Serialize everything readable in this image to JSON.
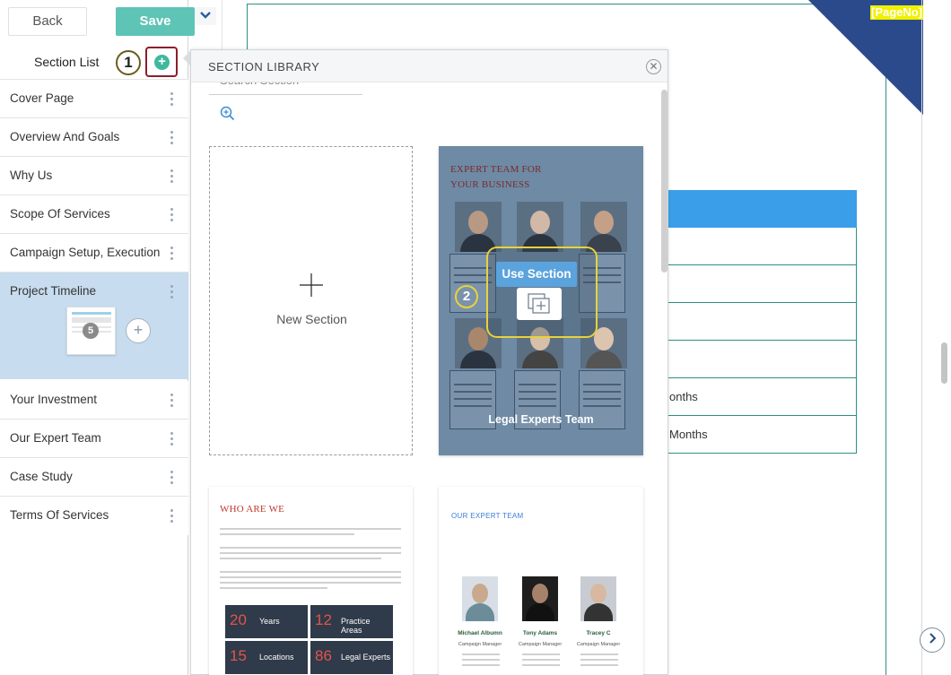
{
  "toolbar": {
    "back_label": "Back",
    "save_label": "Save",
    "dropdown_icon": "chevron-down-icon"
  },
  "section_list": {
    "title": "Section List",
    "step_badge": "1",
    "add_icon": "plus-circle-icon",
    "items": [
      {
        "label": "Cover Page"
      },
      {
        "label": "Overview And Goals"
      },
      {
        "label": "Why Us"
      },
      {
        "label": "Scope Of Services"
      },
      {
        "label": "Campaign Setup, Execution"
      },
      {
        "label": "Project Timeline",
        "active": true,
        "page_number": "5"
      },
      {
        "label": "Your Investment"
      },
      {
        "label": "Our Expert Team"
      },
      {
        "label": "Case Study"
      },
      {
        "label": "Terms Of Services"
      }
    ]
  },
  "library": {
    "title": "SECTION LIBRARY",
    "search_placeholder": "Search Section",
    "close_icon": "close-circle-icon",
    "zoom_icon": "zoom-icon",
    "new_section_label": "New Section",
    "step_badge": "2",
    "use_section_label": "Use Section",
    "cards": [
      {
        "title_lines": [
          "EXPERT TEAM FOR",
          "YOUR BUSINESS"
        ],
        "caption": "Legal Experts Team"
      },
      {
        "title": "WHO ARE WE",
        "stats": [
          {
            "number": "20",
            "label": "Years"
          },
          {
            "number": "12",
            "label": "Practice Areas"
          },
          {
            "number": "15",
            "label": "Locations"
          },
          {
            "number": "86",
            "label": "Legal Experts"
          }
        ]
      },
      {
        "title": "OUR EXPERT TEAM",
        "members": [
          {
            "name": "Michael Albumn",
            "role": "Campaign Manager"
          },
          {
            "name": "Tony Adams",
            "role": "Campaign Manager"
          },
          {
            "name": "Tracey C",
            "role": "Campaign Manager"
          }
        ]
      }
    ]
  },
  "document": {
    "page_no_tag": "[PageNo]",
    "table_rows": [
      "",
      "",
      "",
      "",
      "onths",
      "Months"
    ],
    "next_icon": "chevron-right-icon",
    "colors": {
      "accent": "#2c8f86",
      "header_blue": "#3b9ee8",
      "corner": "#2b4a8b"
    }
  }
}
